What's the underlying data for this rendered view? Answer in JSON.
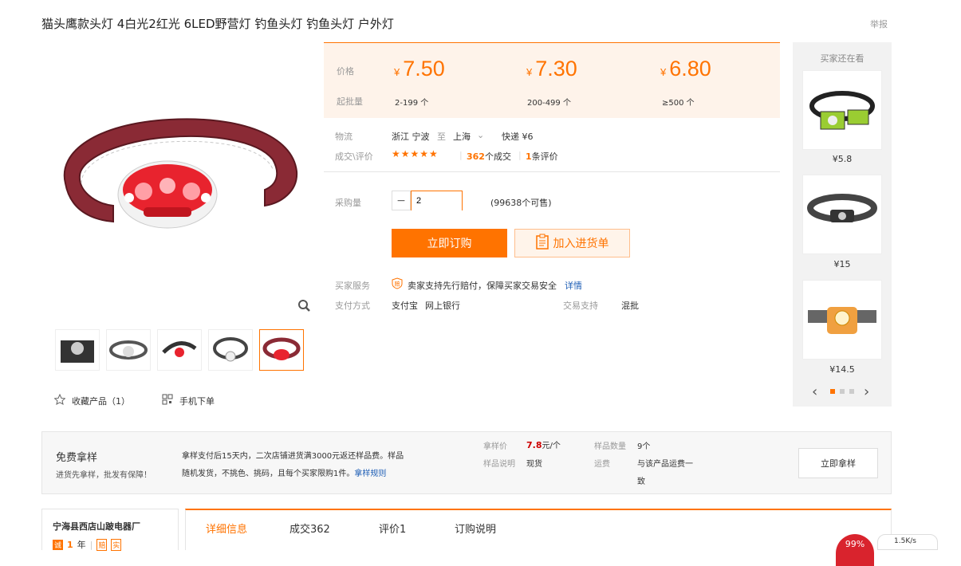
{
  "product": {
    "title": "猫头鹰款头灯 4白光2红光 6LED野营灯 钓鱼头灯 钓鱼头灯 户外灯",
    "report_label": "举报"
  },
  "pricing": {
    "price_label": "价格",
    "moq_label": "起批量",
    "currency": "¥",
    "tiers": [
      {
        "price": "7.50",
        "range": "2-199 个"
      },
      {
        "price": "7.30",
        "range": "200-499 个"
      },
      {
        "price": "6.80",
        "range": "≥500 个"
      }
    ]
  },
  "logistics": {
    "label": "物流",
    "origin": "浙江 宁波",
    "to": "至",
    "destination": "上海",
    "shipping": "快递 ¥6"
  },
  "reviews": {
    "label": "成交\\评价",
    "stars": "★★★★★",
    "deals_count": "362",
    "deals_suffix": "个成交",
    "review_count": "1",
    "review_suffix": "条评价"
  },
  "purchase": {
    "qty_label": "采购量",
    "qty_value": "2",
    "stock": "(99638个可售)",
    "order_button": "立即订购",
    "cart_button": "加入进货单"
  },
  "services": {
    "buyer_service_label": "买家服务",
    "buyer_service_text": "卖家支持先行赔付，保障买家交易安全",
    "detail_link": "详情",
    "payment_label": "支付方式",
    "payment_methods": "支付宝",
    "payment_bank": "网上银行",
    "trade_support_label": "交易支持",
    "trade_support_value": "混批"
  },
  "gallery": {
    "favorite": "收藏产品（1）",
    "mobile": "手机下单"
  },
  "recommend": {
    "title": "买家还在看",
    "items": [
      {
        "price": "¥5.8"
      },
      {
        "price": "¥15"
      },
      {
        "price": "¥14.5"
      }
    ]
  },
  "sample": {
    "title": "免费拿样",
    "subtitle": "进货先拿样，批发有保障！",
    "desc_1": "拿样支付后15天内，二次店铺进货满3000元返还样品费。样品",
    "desc_2": "随机发货，不挑色、挑码，且每个买家限购1件。",
    "rule_link": "拿样规则",
    "price_label": "拿样价",
    "price_value": "7.8",
    "price_unit": "元/个",
    "note_label": "样品说明",
    "note_value": "现货",
    "qty_label": "样品数量",
    "qty_value": "9个",
    "fee_label": "运费",
    "fee_value_1": "与该产品运费一",
    "fee_value_2": "致",
    "button": "立即拿样"
  },
  "shop": {
    "name": "宁海县西店山跛电器厂",
    "years": "1",
    "years_unit": "年"
  },
  "tabs": [
    "详细信息",
    "成交362",
    "评价1",
    "订购说明"
  ],
  "net": {
    "percent": "99%",
    "speed": "1.5K/s"
  }
}
